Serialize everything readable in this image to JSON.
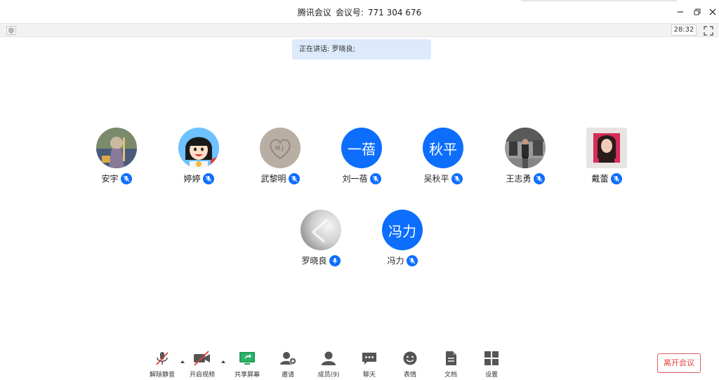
{
  "window": {
    "app_name": "腾讯会议",
    "meeting_id_label": "会议号:",
    "meeting_id": "771 304 676"
  },
  "strip": {
    "timer": "28:32"
  },
  "speaking_banner": "正在讲话: 罗晓良;",
  "participants": [
    {
      "name": "安宇",
      "avatar": "photo-knight"
    },
    {
      "name": "婷婷",
      "avatar": "photo-cartoon-girl"
    },
    {
      "name": "武黎明",
      "avatar": "photo-sand-heart"
    },
    {
      "name": "刘一蓓",
      "avatar": "initials",
      "initials": "一蓓"
    },
    {
      "name": "吴秋平",
      "avatar": "initials",
      "initials": "秋平"
    },
    {
      "name": "王志勇",
      "avatar": "photo-street"
    },
    {
      "name": "戴蕾",
      "avatar": "photo-portrait"
    },
    {
      "name": "罗晓良",
      "avatar": "photo-grey-abstract"
    },
    {
      "name": "冯力",
      "avatar": "initials",
      "initials": "冯力"
    }
  ],
  "toolbar": {
    "unmute": "解除静音",
    "start_video": "开启视频",
    "share_screen": "共享屏幕",
    "invite": "邀请",
    "members": "成员(9)",
    "chat": "聊天",
    "reactions": "表情",
    "docs": "文档",
    "settings": "设置",
    "leave": "离开会议"
  },
  "colors": {
    "accent": "#0d6efd",
    "leave": "#e0403a",
    "banner": "#dceafb"
  }
}
